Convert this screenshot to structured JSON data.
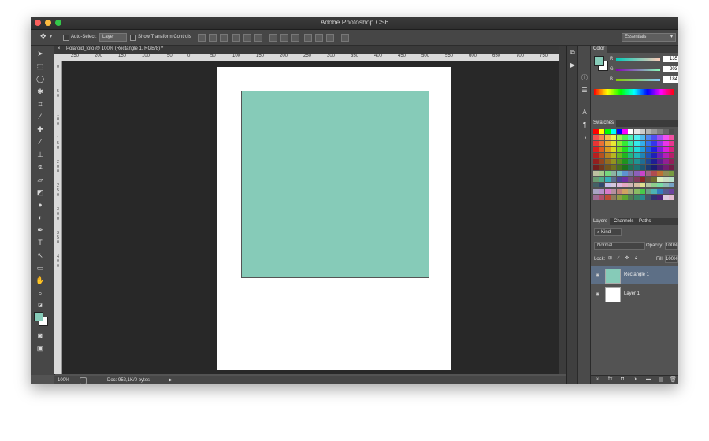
{
  "window": {
    "title": "Adobe Photoshop CS6"
  },
  "options_bar": {
    "move_tool_icon": "move-arrow-icon",
    "auto_select_label": "Auto-Select:",
    "auto_select_value": "Layer",
    "transform_label": "Show Transform Controls",
    "workspace": "Essentials"
  },
  "document": {
    "tab_title": "Polaroid_foto @ 100% (Rectangle 1, RGB/8) *",
    "close_glyph": "×",
    "zoom": "100%",
    "doc_info": "Doc: 952,1K/0 bytes"
  },
  "rulers": {
    "horizontal": [
      "250",
      "200",
      "150",
      "100",
      "50",
      "0",
      "50",
      "100",
      "150",
      "200",
      "250",
      "300",
      "350",
      "400",
      "450",
      "500",
      "550",
      "600",
      "650",
      "700",
      "750"
    ],
    "vertical": [
      "0",
      "5",
      "0",
      "1",
      "0",
      "0",
      "1",
      "5",
      "0",
      "2",
      "0",
      "0",
      "2",
      "5",
      "0",
      "3",
      "0",
      "0",
      "3",
      "5",
      "0",
      "4",
      "0",
      "0"
    ]
  },
  "colors": {
    "rectangle_fill": "#86cbb8",
    "foreground": "#86cbb8",
    "background": "#ffffff",
    "canvas_bg": "#282828",
    "ui_dark": "#535353"
  },
  "color_panel": {
    "tab": "Color",
    "channels": [
      {
        "label": "R",
        "value": "135"
      },
      {
        "label": "G",
        "value": "203"
      },
      {
        "label": "B",
        "value": "184"
      }
    ]
  },
  "swatches_panel": {
    "tab": "Swatches"
  },
  "layers_panel": {
    "tabs": [
      "Layers",
      "Channels",
      "Paths"
    ],
    "filter": "Kind",
    "blend_mode": "Normal",
    "opacity_label": "Opacity:",
    "opacity_value": "100%",
    "lock_label": "Lock:",
    "fill_label": "Fill:",
    "fill_value": "100%",
    "layers": [
      {
        "name": "Rectangle 1",
        "selected": true,
        "thumb_color": "#86cbb8"
      },
      {
        "name": "Layer 1",
        "selected": false,
        "thumb_color": "#ffffff"
      }
    ]
  }
}
